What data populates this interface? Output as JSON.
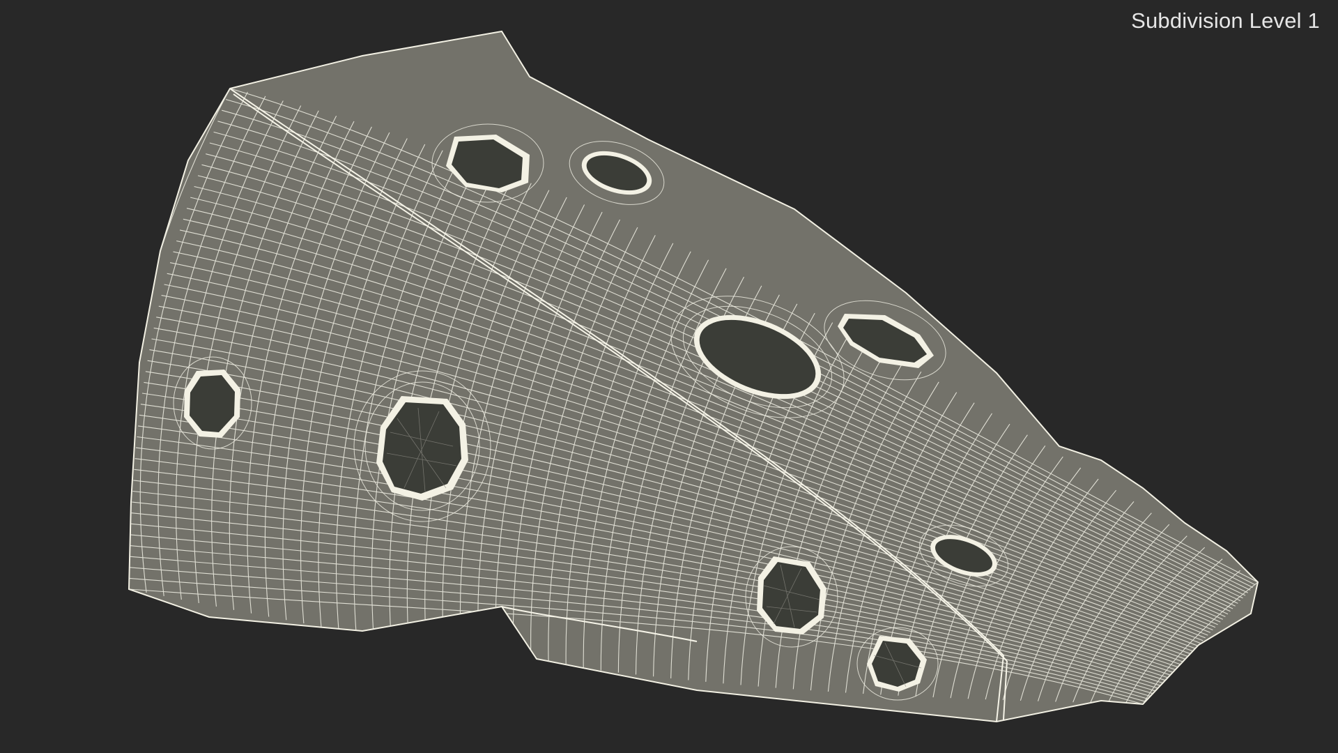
{
  "viewport": {
    "subdivision_label": "Subdivision Level 1",
    "background_color": "#282828",
    "mesh_fill_color": "#73726a",
    "wire_color": "#f3f1e4",
    "hole_color": "#3a3c36"
  },
  "model": {
    "name_icon": "wedge-mesh-wireframe",
    "hole_count": 9
  }
}
